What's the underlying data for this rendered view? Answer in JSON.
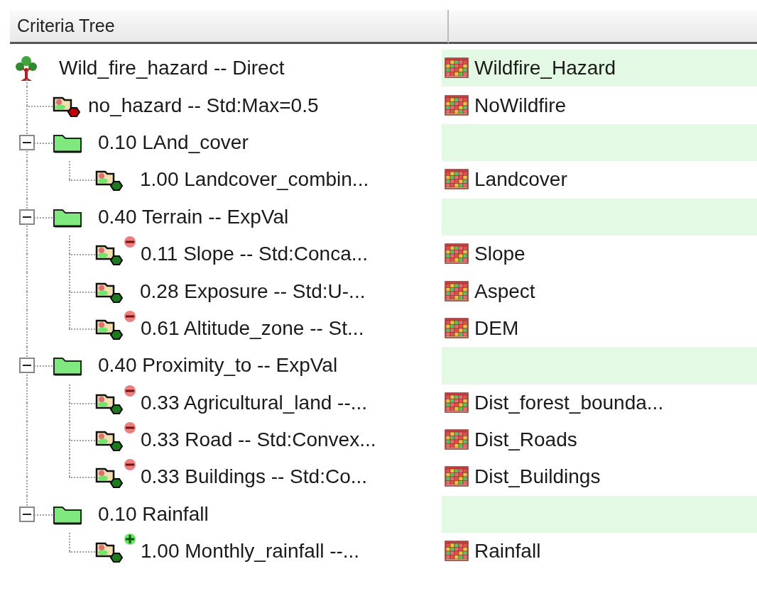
{
  "header": {
    "title": "Criteria Tree"
  },
  "tree": {
    "kind": "root",
    "label": "Wild_fire_hazard -- Direct",
    "layer": "Wildfire_Hazard",
    "children": [
      {
        "kind": "constraint",
        "label": "no_hazard -- Std:Max=0.5",
        "layer": "NoWildfire"
      },
      {
        "kind": "group",
        "label": "0.10 LAnd_cover",
        "expanded": true,
        "children": [
          {
            "kind": "factor",
            "minus_badge": false,
            "plus_badge": false,
            "label": "1.00 Landcover_combin...",
            "layer": "Landcover"
          }
        ]
      },
      {
        "kind": "group",
        "label": "0.40 Terrain -- ExpVal",
        "expanded": true,
        "children": [
          {
            "kind": "factor",
            "minus_badge": true,
            "plus_badge": false,
            "label": "0.11 Slope -- Std:Conca...",
            "layer": "Slope"
          },
          {
            "kind": "factor",
            "minus_badge": false,
            "plus_badge": false,
            "label": "0.28 Exposure -- Std:U-...",
            "layer": "Aspect"
          },
          {
            "kind": "factor",
            "minus_badge": true,
            "plus_badge": false,
            "label": "0.61 Altitude_zone -- St...",
            "layer": "DEM"
          }
        ]
      },
      {
        "kind": "group",
        "label": "0.40 Proximity_to -- ExpVal",
        "expanded": true,
        "children": [
          {
            "kind": "factor",
            "minus_badge": true,
            "plus_badge": false,
            "label": "0.33 Agricultural_land --...",
            "layer": "Dist_forest_bounda..."
          },
          {
            "kind": "factor",
            "minus_badge": true,
            "plus_badge": false,
            "label": "0.33 Road -- Std:Convex...",
            "layer": "Dist_Roads"
          },
          {
            "kind": "factor",
            "minus_badge": true,
            "plus_badge": false,
            "label": "0.33 Buildings -- Std:Co...",
            "layer": "Dist_Buildings"
          }
        ]
      },
      {
        "kind": "group",
        "label": "0.10 Rainfall",
        "expanded": true,
        "children": [
          {
            "kind": "factor",
            "minus_badge": false,
            "plus_badge": true,
            "label": "1.00 Monthly_rainfall --...",
            "layer": "Rainfall"
          }
        ]
      }
    ]
  }
}
